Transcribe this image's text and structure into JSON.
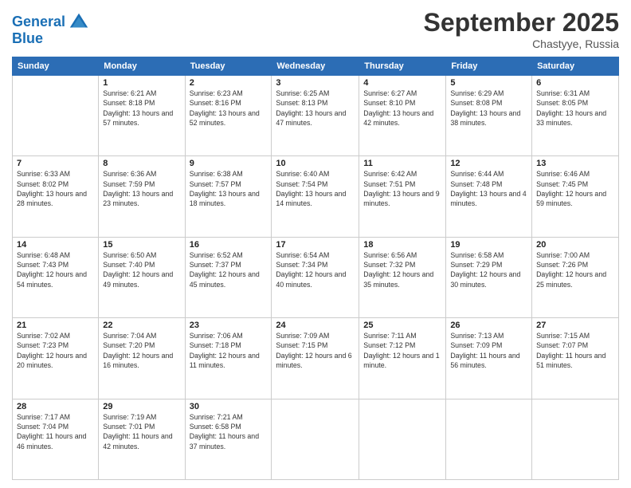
{
  "header": {
    "logo_line1": "General",
    "logo_line2": "Blue",
    "month": "September 2025",
    "location": "Chastyye, Russia"
  },
  "weekdays": [
    "Sunday",
    "Monday",
    "Tuesday",
    "Wednesday",
    "Thursday",
    "Friday",
    "Saturday"
  ],
  "weeks": [
    [
      {
        "day": "",
        "sunrise": "",
        "sunset": "",
        "daylight": ""
      },
      {
        "day": "1",
        "sunrise": "Sunrise: 6:21 AM",
        "sunset": "Sunset: 8:18 PM",
        "daylight": "Daylight: 13 hours and 57 minutes."
      },
      {
        "day": "2",
        "sunrise": "Sunrise: 6:23 AM",
        "sunset": "Sunset: 8:16 PM",
        "daylight": "Daylight: 13 hours and 52 minutes."
      },
      {
        "day": "3",
        "sunrise": "Sunrise: 6:25 AM",
        "sunset": "Sunset: 8:13 PM",
        "daylight": "Daylight: 13 hours and 47 minutes."
      },
      {
        "day": "4",
        "sunrise": "Sunrise: 6:27 AM",
        "sunset": "Sunset: 8:10 PM",
        "daylight": "Daylight: 13 hours and 42 minutes."
      },
      {
        "day": "5",
        "sunrise": "Sunrise: 6:29 AM",
        "sunset": "Sunset: 8:08 PM",
        "daylight": "Daylight: 13 hours and 38 minutes."
      },
      {
        "day": "6",
        "sunrise": "Sunrise: 6:31 AM",
        "sunset": "Sunset: 8:05 PM",
        "daylight": "Daylight: 13 hours and 33 minutes."
      }
    ],
    [
      {
        "day": "7",
        "sunrise": "Sunrise: 6:33 AM",
        "sunset": "Sunset: 8:02 PM",
        "daylight": "Daylight: 13 hours and 28 minutes."
      },
      {
        "day": "8",
        "sunrise": "Sunrise: 6:36 AM",
        "sunset": "Sunset: 7:59 PM",
        "daylight": "Daylight: 13 hours and 23 minutes."
      },
      {
        "day": "9",
        "sunrise": "Sunrise: 6:38 AM",
        "sunset": "Sunset: 7:57 PM",
        "daylight": "Daylight: 13 hours and 18 minutes."
      },
      {
        "day": "10",
        "sunrise": "Sunrise: 6:40 AM",
        "sunset": "Sunset: 7:54 PM",
        "daylight": "Daylight: 13 hours and 14 minutes."
      },
      {
        "day": "11",
        "sunrise": "Sunrise: 6:42 AM",
        "sunset": "Sunset: 7:51 PM",
        "daylight": "Daylight: 13 hours and 9 minutes."
      },
      {
        "day": "12",
        "sunrise": "Sunrise: 6:44 AM",
        "sunset": "Sunset: 7:48 PM",
        "daylight": "Daylight: 13 hours and 4 minutes."
      },
      {
        "day": "13",
        "sunrise": "Sunrise: 6:46 AM",
        "sunset": "Sunset: 7:45 PM",
        "daylight": "Daylight: 12 hours and 59 minutes."
      }
    ],
    [
      {
        "day": "14",
        "sunrise": "Sunrise: 6:48 AM",
        "sunset": "Sunset: 7:43 PM",
        "daylight": "Daylight: 12 hours and 54 minutes."
      },
      {
        "day": "15",
        "sunrise": "Sunrise: 6:50 AM",
        "sunset": "Sunset: 7:40 PM",
        "daylight": "Daylight: 12 hours and 49 minutes."
      },
      {
        "day": "16",
        "sunrise": "Sunrise: 6:52 AM",
        "sunset": "Sunset: 7:37 PM",
        "daylight": "Daylight: 12 hours and 45 minutes."
      },
      {
        "day": "17",
        "sunrise": "Sunrise: 6:54 AM",
        "sunset": "Sunset: 7:34 PM",
        "daylight": "Daylight: 12 hours and 40 minutes."
      },
      {
        "day": "18",
        "sunrise": "Sunrise: 6:56 AM",
        "sunset": "Sunset: 7:32 PM",
        "daylight": "Daylight: 12 hours and 35 minutes."
      },
      {
        "day": "19",
        "sunrise": "Sunrise: 6:58 AM",
        "sunset": "Sunset: 7:29 PM",
        "daylight": "Daylight: 12 hours and 30 minutes."
      },
      {
        "day": "20",
        "sunrise": "Sunrise: 7:00 AM",
        "sunset": "Sunset: 7:26 PM",
        "daylight": "Daylight: 12 hours and 25 minutes."
      }
    ],
    [
      {
        "day": "21",
        "sunrise": "Sunrise: 7:02 AM",
        "sunset": "Sunset: 7:23 PM",
        "daylight": "Daylight: 12 hours and 20 minutes."
      },
      {
        "day": "22",
        "sunrise": "Sunrise: 7:04 AM",
        "sunset": "Sunset: 7:20 PM",
        "daylight": "Daylight: 12 hours and 16 minutes."
      },
      {
        "day": "23",
        "sunrise": "Sunrise: 7:06 AM",
        "sunset": "Sunset: 7:18 PM",
        "daylight": "Daylight: 12 hours and 11 minutes."
      },
      {
        "day": "24",
        "sunrise": "Sunrise: 7:09 AM",
        "sunset": "Sunset: 7:15 PM",
        "daylight": "Daylight: 12 hours and 6 minutes."
      },
      {
        "day": "25",
        "sunrise": "Sunrise: 7:11 AM",
        "sunset": "Sunset: 7:12 PM",
        "daylight": "Daylight: 12 hours and 1 minute."
      },
      {
        "day": "26",
        "sunrise": "Sunrise: 7:13 AM",
        "sunset": "Sunset: 7:09 PM",
        "daylight": "Daylight: 11 hours and 56 minutes."
      },
      {
        "day": "27",
        "sunrise": "Sunrise: 7:15 AM",
        "sunset": "Sunset: 7:07 PM",
        "daylight": "Daylight: 11 hours and 51 minutes."
      }
    ],
    [
      {
        "day": "28",
        "sunrise": "Sunrise: 7:17 AM",
        "sunset": "Sunset: 7:04 PM",
        "daylight": "Daylight: 11 hours and 46 minutes."
      },
      {
        "day": "29",
        "sunrise": "Sunrise: 7:19 AM",
        "sunset": "Sunset: 7:01 PM",
        "daylight": "Daylight: 11 hours and 42 minutes."
      },
      {
        "day": "30",
        "sunrise": "Sunrise: 7:21 AM",
        "sunset": "Sunset: 6:58 PM",
        "daylight": "Daylight: 11 hours and 37 minutes."
      },
      {
        "day": "",
        "sunrise": "",
        "sunset": "",
        "daylight": ""
      },
      {
        "day": "",
        "sunrise": "",
        "sunset": "",
        "daylight": ""
      },
      {
        "day": "",
        "sunrise": "",
        "sunset": "",
        "daylight": ""
      },
      {
        "day": "",
        "sunrise": "",
        "sunset": "",
        "daylight": ""
      }
    ]
  ]
}
